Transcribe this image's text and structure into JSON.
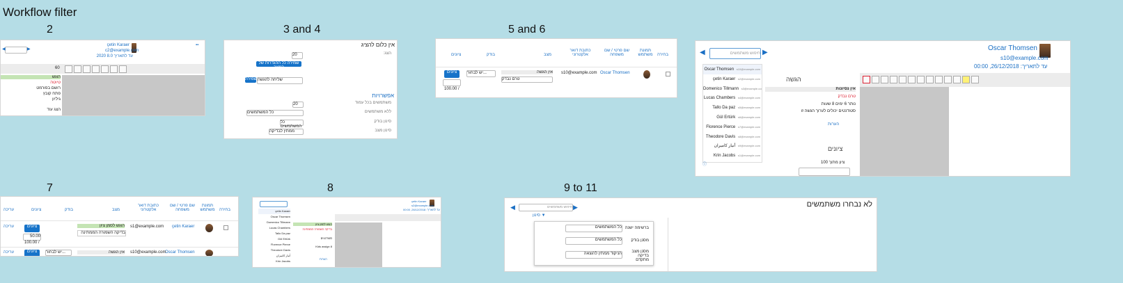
{
  "page": {
    "title": "Workflow filter"
  },
  "labels": {
    "s2": "2",
    "s3": "3 and 4",
    "s5": "5 and 6",
    "s7": "7",
    "s8": "8",
    "s9": "9 to 11"
  },
  "panel2": {
    "user_name": "çetin Karaer",
    "user_email": "c2@example.com",
    "due": "עד לתאריך 8.0 2020",
    "status_green": "הוגש",
    "status_red": "טיוטה",
    "lines": [
      "רושם בפורמט",
      "פתח קובץ",
      "גיליון",
      "הצג עוד"
    ],
    "page_ind": "60",
    "grade_btn": "Mxa"
  },
  "panel3": {
    "title": "אין כלום להציג",
    "filter_label": "הצג:",
    "btn_apply": "שמירה",
    "section": "אפשרויות",
    "rows": [
      "משתמשים בכל עמוד",
      "ללא משתמשים",
      "סינון בודק",
      "סינון מצב"
    ],
    "select1": "20",
    "select2": "כל המשתמשים",
    "select3": "כל המשתמשים",
    "select4": "ממתין לבדיקה",
    "btn_long": "שמירה כל ההגדרות של המצב",
    "per_page": "20",
    "apply_filter_select": "שליחה להגשה"
  },
  "panel5": {
    "headers": [
      "בחירה",
      "תמונת משתמש",
      "שם פרטי / שם משפחה",
      "כתובת דואר אלקטרוני",
      "מצב",
      "בודק",
      "ציונים"
    ],
    "row": {
      "name": "Oscar Thomsen",
      "email": "s10@example.com",
      "status": "אין הגשה",
      "status_sel": "טרם נבדק",
      "marker_sel": "יש לבחור...",
      "grade_btn": "ציונים",
      "grade_max": "100.00 /"
    }
  },
  "panel_right": {
    "user_name": "Oscar Thomsen",
    "user_email": "s10@example.com",
    "due": "עד לתאריך: 26/12/2018, 00:00",
    "search_placeholder": "חיפוש משתמשים",
    "users": [
      {
        "name": "Oscar Thomsen",
        "email": "s10@example.com"
      },
      {
        "name": "çetin Karaer",
        "email": "s2@example.com"
      },
      {
        "name": "Domenico Tillmann",
        "email": "s3@example.com"
      },
      {
        "name": "Lucas Chambers",
        "email": "s4@example.com"
      },
      {
        "name": "Tallo Da paz",
        "email": "s5@example.com"
      },
      {
        "name": "Gül Ertürk",
        "email": "s6@example.com"
      },
      {
        "name": "Florence Pierce",
        "email": "s7@example.com"
      },
      {
        "name": "Theodore Davis",
        "email": "s8@example.com"
      },
      {
        "name": "أنيار كاميران",
        "email": "s9@example.com"
      },
      {
        "name": "Krin Jacobs",
        "email": "s1@example.com"
      }
    ],
    "submission_heading": "הגשה",
    "no_attempt": "אין נסיונות",
    "not_graded": "טרם נבדק",
    "remaining": "נותר 6 ימים 8 שעות",
    "students_can_edit": "סטודנטים יכולים לערוך הגשה זו",
    "comments": "הערות",
    "grades_heading": "ציונים",
    "grade_out_of": "ציון מתוך 100"
  },
  "panel7": {
    "headers": [
      "בחירה",
      "תמונת משתמש",
      "שם פרטי / שם משפחה",
      "כתובת דואר אלקטרוני",
      "מצב",
      "בודק",
      "ציונים",
      "עריכה"
    ],
    "rows": [
      {
        "name": "çetin Karaer",
        "email": "s1@example.com",
        "status1": "הוגש לסמן ציון",
        "status2": "בדיקה השמורה הממתינה",
        "grade_btn": "ציונים",
        "grade_val": "50.00",
        "grade_max": "100.00 /",
        "edit": "עריכה"
      },
      {
        "name": "Oscar Thomsen",
        "email": "s10@example.com",
        "status1": "אין הגשה",
        "marker": "יש לבחור...",
        "grade_btn": "ציונים",
        "edit": "עריכה"
      }
    ]
  },
  "panel8": {
    "user_name": "çetin Karaer",
    "user_email": "s2@example.com",
    "due": "עד לתאריך: 26/12/2018, 00:00",
    "users": [
      "çetin Karaer",
      "Oscar Thomsen",
      "Domenico Tillmann",
      "Lucas Chambers",
      "Tallo Da paz",
      "Gül Ertürk",
      "Florence Pierce",
      "Theodore Davis",
      "أنيار كاميران",
      "Krin Jacobs"
    ],
    "status": "הוגש לסמן ציון",
    "red": "בדיקה השמורה הממתינה",
    "extra": [
      "סטודנטים",
      "Kids assign 8"
    ],
    "comments": "הערות"
  },
  "panel9": {
    "title": "לא נבחרו משתמשים",
    "search_placeholder": "חיפוש משתמשים",
    "filter_link": "סינון",
    "rows": [
      {
        "label": "ברשימה ישנה",
        "value": "כל המשתמשים"
      },
      {
        "label": "מסנן בודק",
        "value": "כל המשתמשים"
      },
      {
        "label": "מסנן מצב בדיקה מתקדם",
        "value": "הניקוד ממתין להוצאה"
      }
    ]
  },
  "colors": {
    "background": "#b5dde6",
    "accent": "#1673c9",
    "green": "#5cb85c",
    "red": "#d23"
  }
}
